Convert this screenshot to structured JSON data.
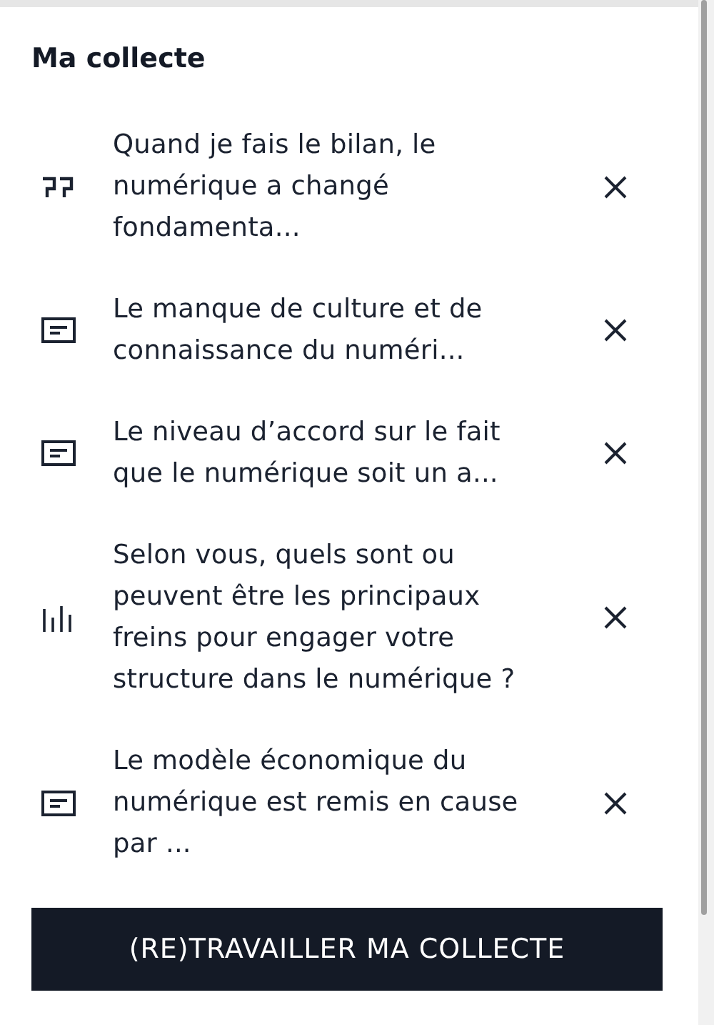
{
  "title": "Ma collecte",
  "items": [
    {
      "kind": "quote",
      "lines": [
        "Quand je fais le bilan, le",
        "numérique a changé",
        "fondamenta..."
      ]
    },
    {
      "kind": "text",
      "lines": [
        "Le manque de culture et de",
        "connaissance du numéri..."
      ]
    },
    {
      "kind": "text",
      "lines": [
        "Le niveau d’accord sur le fait",
        "que le numérique soit un a..."
      ]
    },
    {
      "kind": "chart",
      "lines": [
        "Selon vous, quels sont ou",
        "peuvent être les principaux",
        "freins pour engager votre",
        "structure dans le numérique ?"
      ]
    },
    {
      "kind": "text",
      "lines": [
        "Le modèle économique du",
        "numérique est remis en cause",
        "par ..."
      ]
    }
  ],
  "button": "(RE)TRAVAILLER MA COLLECTE"
}
